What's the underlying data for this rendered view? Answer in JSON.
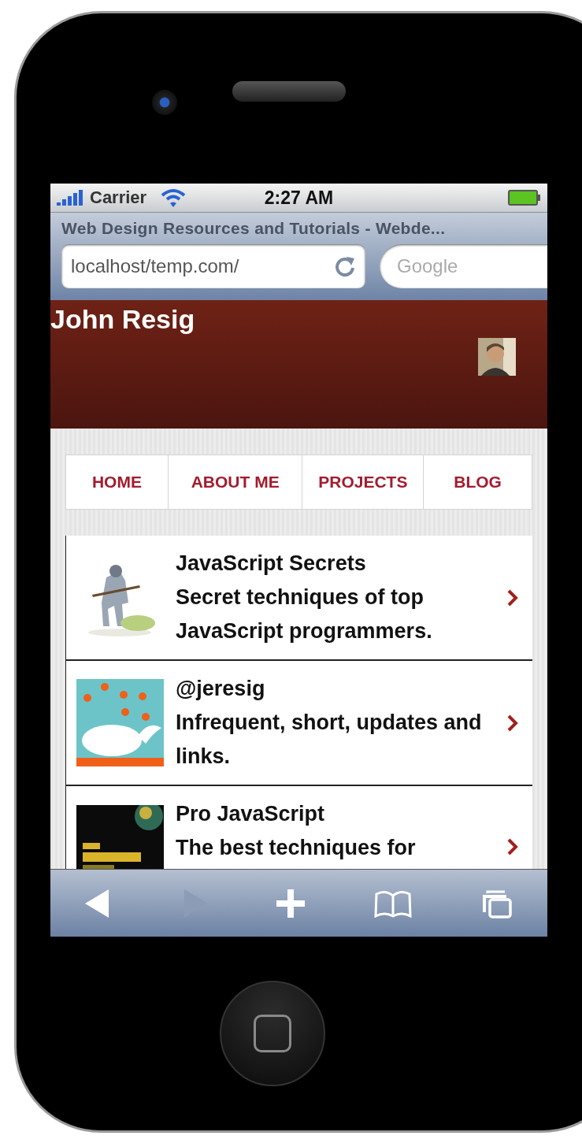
{
  "status_bar": {
    "carrier": "Carrier",
    "time": "2:27 AM"
  },
  "browser": {
    "page_title": "Web Design Resources and Tutorials - Webde...",
    "url": "localhost/temp.com/",
    "search": {
      "placeholder": "Google"
    }
  },
  "header": {
    "title": "John Resig"
  },
  "nav": [
    {
      "label": "HOME"
    },
    {
      "label": "ABOUT ME"
    },
    {
      "label": "PROJECTS"
    },
    {
      "label": "BLOG"
    }
  ],
  "list": [
    {
      "title": "JavaScript Secrets",
      "subtitle": "Secret techniques of top JavaScript programmers."
    },
    {
      "title": "@jeresig",
      "subtitle": "Infrequent, short, updates and links."
    },
    {
      "title": "Pro JavaScript",
      "subtitle": "The best techniques for"
    }
  ],
  "toolbar": [
    {
      "kind": "back",
      "disabled": false
    },
    {
      "kind": "forward",
      "disabled": true
    },
    {
      "kind": "add",
      "disabled": false
    },
    {
      "kind": "bookmarks",
      "disabled": false
    },
    {
      "kind": "tabs",
      "disabled": false
    }
  ]
}
